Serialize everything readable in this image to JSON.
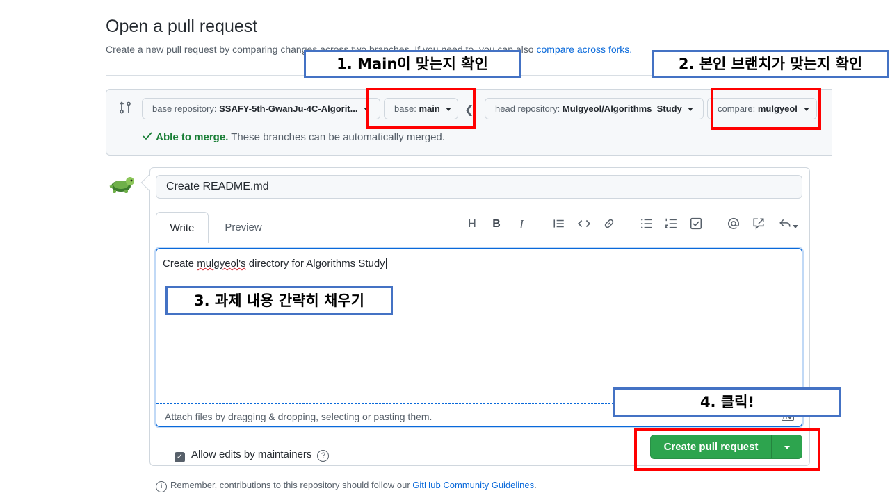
{
  "header": {
    "title": "Open a pull request",
    "subtitle_prefix": "Create a new pull request by comparing changes across two branches. If you need to, you can also",
    "subtitle_link": "compare across forks."
  },
  "range": {
    "base_repo_label": "base repository:",
    "base_repo_value": "SSAFY-5th-GwanJu-4C-Algorit...",
    "base_label": "base:",
    "base_value": "main",
    "head_repo_label": "head repository:",
    "head_repo_value": "Mulgyeol/Algorithms_Study",
    "compare_label": "compare:",
    "compare_value": "mulgyeol",
    "merge_status": "Able to merge.",
    "merge_detail": "These branches can be automatically merged."
  },
  "form": {
    "title_value": "Create README.md",
    "tabs": [
      {
        "label": "Write"
      },
      {
        "label": "Preview"
      }
    ],
    "toolbar": {
      "heading": "H",
      "bold": "B",
      "italic": "I"
    },
    "body_prefix": "Create ",
    "body_misspelled": "mulgyeol's",
    "body_suffix": " directory for Algorithms Study",
    "attach_hint": "Attach files by dragging & dropping, selecting or pasting them.",
    "allow_edits_label": "Allow edits by maintainers",
    "help": "?",
    "submit_label": "Create pull request"
  },
  "footer": {
    "info": "i",
    "prefix": "Remember, contributions to this repository should follow our",
    "link": "GitHub Community Guidelines",
    "suffix": "."
  },
  "annotations": {
    "step1": "1. Main이 맞는지 확인",
    "step2": "2. 본인 브랜치가 맞는지 확인",
    "step3": "3. 과제 내용 간략히 채우기",
    "step4": "4. 클릭!"
  },
  "colors": {
    "accent": "#0969da",
    "success": "#2da44e",
    "annotation_red": "#ff0000",
    "annotation_blue": "#4472c4"
  },
  "icons": {
    "compare": "git-compare-icon",
    "check": "check-icon",
    "avatar": "turtle-avatar",
    "markdown": "markdown-icon"
  }
}
